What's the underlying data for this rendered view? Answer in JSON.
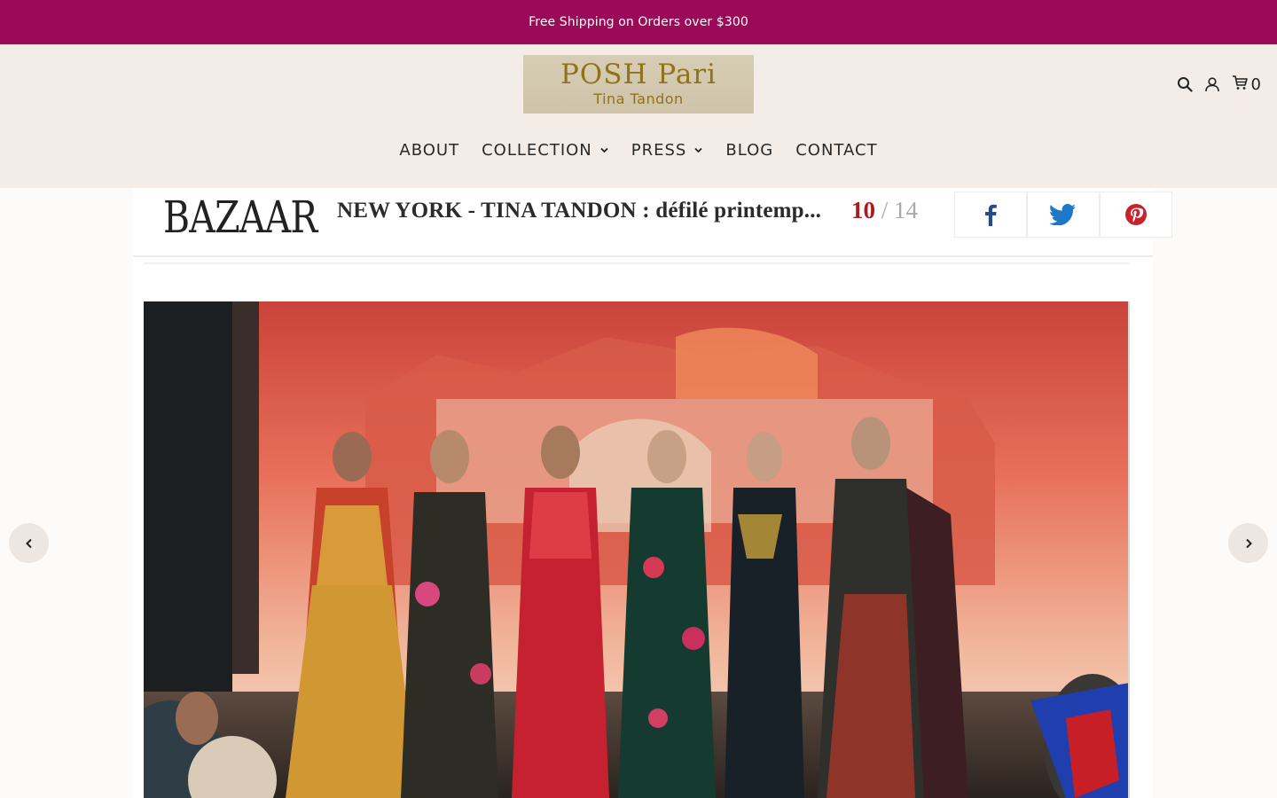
{
  "announcement": {
    "text": "Free Shipping on Orders over $300"
  },
  "logo": {
    "brand": "POSH Pari",
    "subtitle": "Tina Tandon"
  },
  "header_icons": {
    "search": "search-icon",
    "account": "user-icon",
    "cart": "cart-icon",
    "cart_count": "0"
  },
  "nav": {
    "items": [
      {
        "label": "ABOUT",
        "dropdown": false
      },
      {
        "label": "COLLECTION",
        "dropdown": true
      },
      {
        "label": "PRESS",
        "dropdown": true
      },
      {
        "label": "BLOG",
        "dropdown": false
      },
      {
        "label": "CONTACT",
        "dropdown": false
      }
    ]
  },
  "article": {
    "publication": "BAZAAR",
    "headline": "NEW YORK - TINA TANDON : défilé printemp...",
    "page_current": "10",
    "page_separator": " / ",
    "page_total": "14",
    "share": [
      "facebook-icon",
      "twitter-icon",
      "pinterest-icon"
    ]
  },
  "slider": {
    "prev": "chevron-left-icon",
    "next": "chevron-right-icon"
  },
  "colors": {
    "announcement_bg": "#9b0a56",
    "header_bg": "#f4ede7",
    "logo_gold": "#8f7417",
    "accent_red": "#b31818"
  }
}
